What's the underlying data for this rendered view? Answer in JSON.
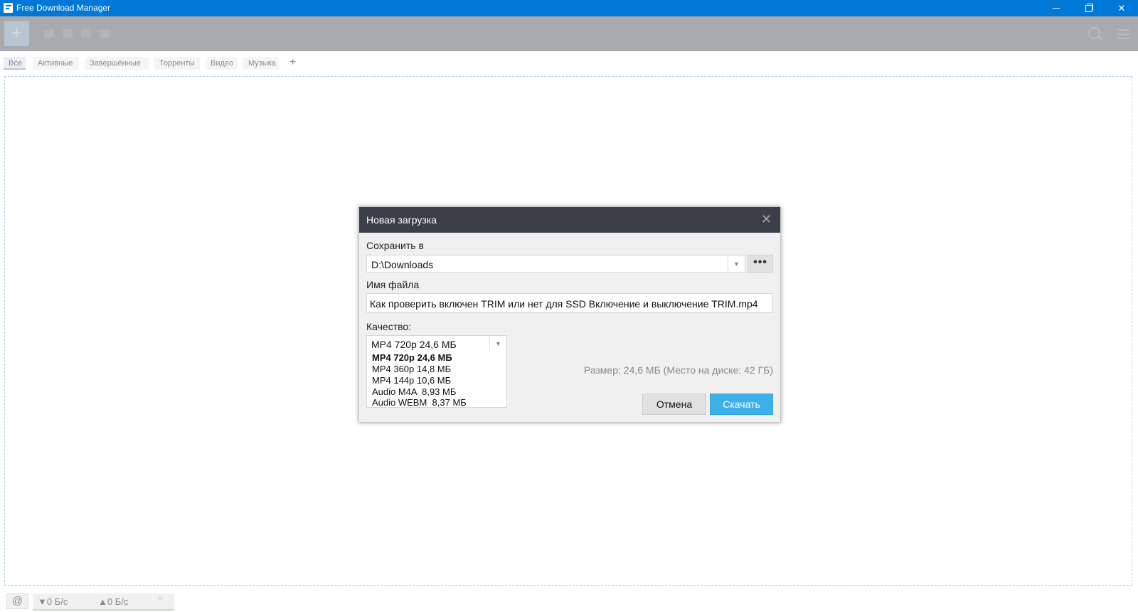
{
  "window": {
    "title": "Free Download Manager",
    "accent_color": "#0078d7",
    "controls": {
      "minimize": "minimize-icon",
      "maximize": "restore-icon",
      "close": "✕"
    }
  },
  "toolbar": {
    "add_label": "+",
    "search_icon": "search-icon",
    "menu_icon": "hamburger-menu-icon"
  },
  "tabs": [
    {
      "label": "Все"
    },
    {
      "label": "Активные"
    },
    {
      "label": "Завершённые"
    },
    {
      "label": "Торренты"
    },
    {
      "label": "Видео"
    },
    {
      "label": "Музыка"
    }
  ],
  "tabs_add_label": "+",
  "status": {
    "snail_icon": "snail-icon",
    "down_speed": "▼0 Б/с",
    "up_speed": "▲0 Б/с",
    "expand_icon": "^"
  },
  "dialog": {
    "title": "Новая загрузка",
    "close_label": "✕",
    "save_to_label": "Сохранить в",
    "save_to_value": "D:\\Downloads",
    "browse_label": "•••",
    "filename_label": "Имя файла",
    "filename_value": "Как проверить включен TRIM или нет для SSD Включение и выключение TRIM.mp4",
    "quality_label": "Качество:",
    "quality_selected": "MP4 720p 24,6 МБ",
    "quality_options": [
      "MP4 720p 24,6 МБ",
      "MP4 360p 14,8 МБ",
      "MP4 144p 10,6 МБ",
      "Audio M4A  8,93 МБ",
      "Audio WEBM  8,37 МБ"
    ],
    "size_info": "Размер: 24,6 МБ (Место на диске: 42 ГБ)",
    "cancel_label": "Отмена",
    "download_label": "Скачать",
    "download_color": "#3cb0ea"
  }
}
